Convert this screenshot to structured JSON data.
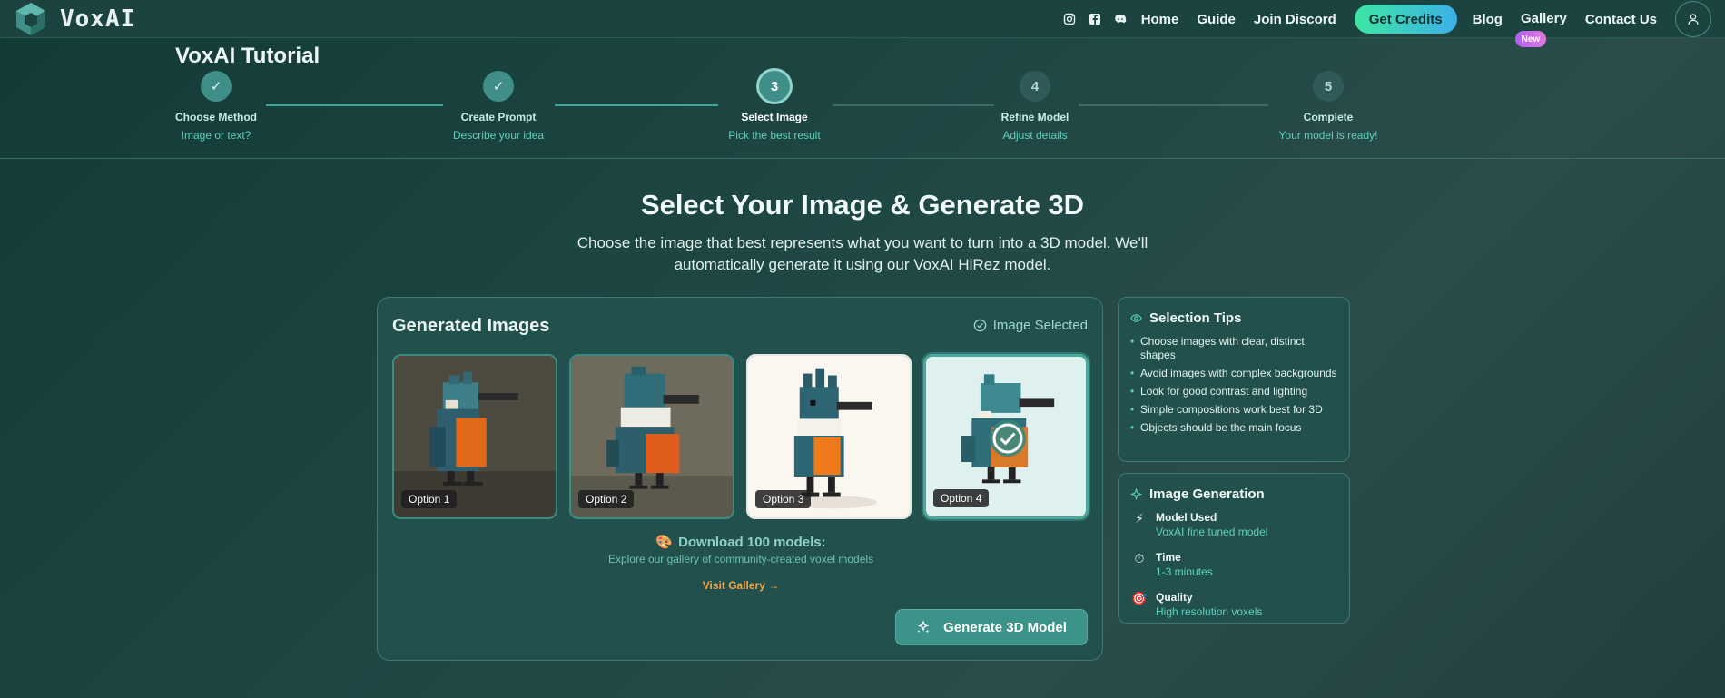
{
  "nav": {
    "brand": "VoxAI",
    "social": [
      "instagram-icon",
      "facebook-icon",
      "discord-icon"
    ],
    "links": [
      "Home",
      "Guide",
      "Join Discord"
    ],
    "cta": "Get Credits",
    "links_after": [
      "Blog",
      "Gallery",
      "Contact Us"
    ],
    "gallery_badge": "New"
  },
  "tutorial": {
    "title": "VoxAI Tutorial",
    "steps": [
      {
        "marker": "✓",
        "label": "Choose Method",
        "sub": "Image or text?",
        "state": "done"
      },
      {
        "marker": "✓",
        "label": "Create Prompt",
        "sub": "Describe your idea",
        "state": "done"
      },
      {
        "marker": "3",
        "label": "Select Image",
        "sub": "Pick the best result",
        "state": "active"
      },
      {
        "marker": "4",
        "label": "Refine Model",
        "sub": "Adjust details",
        "state": "todo"
      },
      {
        "marker": "5",
        "label": "Complete",
        "sub": "Your model is ready!",
        "state": "todo"
      }
    ]
  },
  "hero": {
    "title": "Select Your Image & Generate 3D",
    "subtitle": "Choose the image that best represents what you want to turn into a 3D model. We'll automatically generate it using our VoxAI HiRez model."
  },
  "panel": {
    "title": "Generated Images",
    "selected_status": "Image Selected",
    "options": [
      "Option 1",
      "Option 2",
      "Option 3",
      "Option 4"
    ],
    "selected_index": 3,
    "download_title": "Download 100 models:",
    "download_sub": "Explore our gallery of community-created voxel models",
    "visit_link": "Visit Gallery →",
    "generate_button": "Generate 3D Model"
  },
  "tips": {
    "title": "Selection Tips",
    "items": [
      "Choose images with clear, distinct shapes",
      "Avoid images with complex backgrounds",
      "Look for good contrast and lighting",
      "Simple compositions work best for 3D",
      "Objects should be the main focus"
    ]
  },
  "generation": {
    "title": "Image Generation",
    "items": [
      {
        "icon": "lightning-icon",
        "key": "Model Used",
        "value": "VoxAI fine tuned model"
      },
      {
        "icon": "timer-icon",
        "key": "Time",
        "value": "1-3 minutes"
      },
      {
        "icon": "target-icon",
        "key": "Quality",
        "value": "High resolution voxels"
      }
    ]
  },
  "colors": {
    "accent": "#3f8f88",
    "highlight": "#5fd0bf",
    "link_orange": "#f0a24a",
    "cta_start": "#3ee6a2",
    "cta_end": "#3cb0e8"
  }
}
